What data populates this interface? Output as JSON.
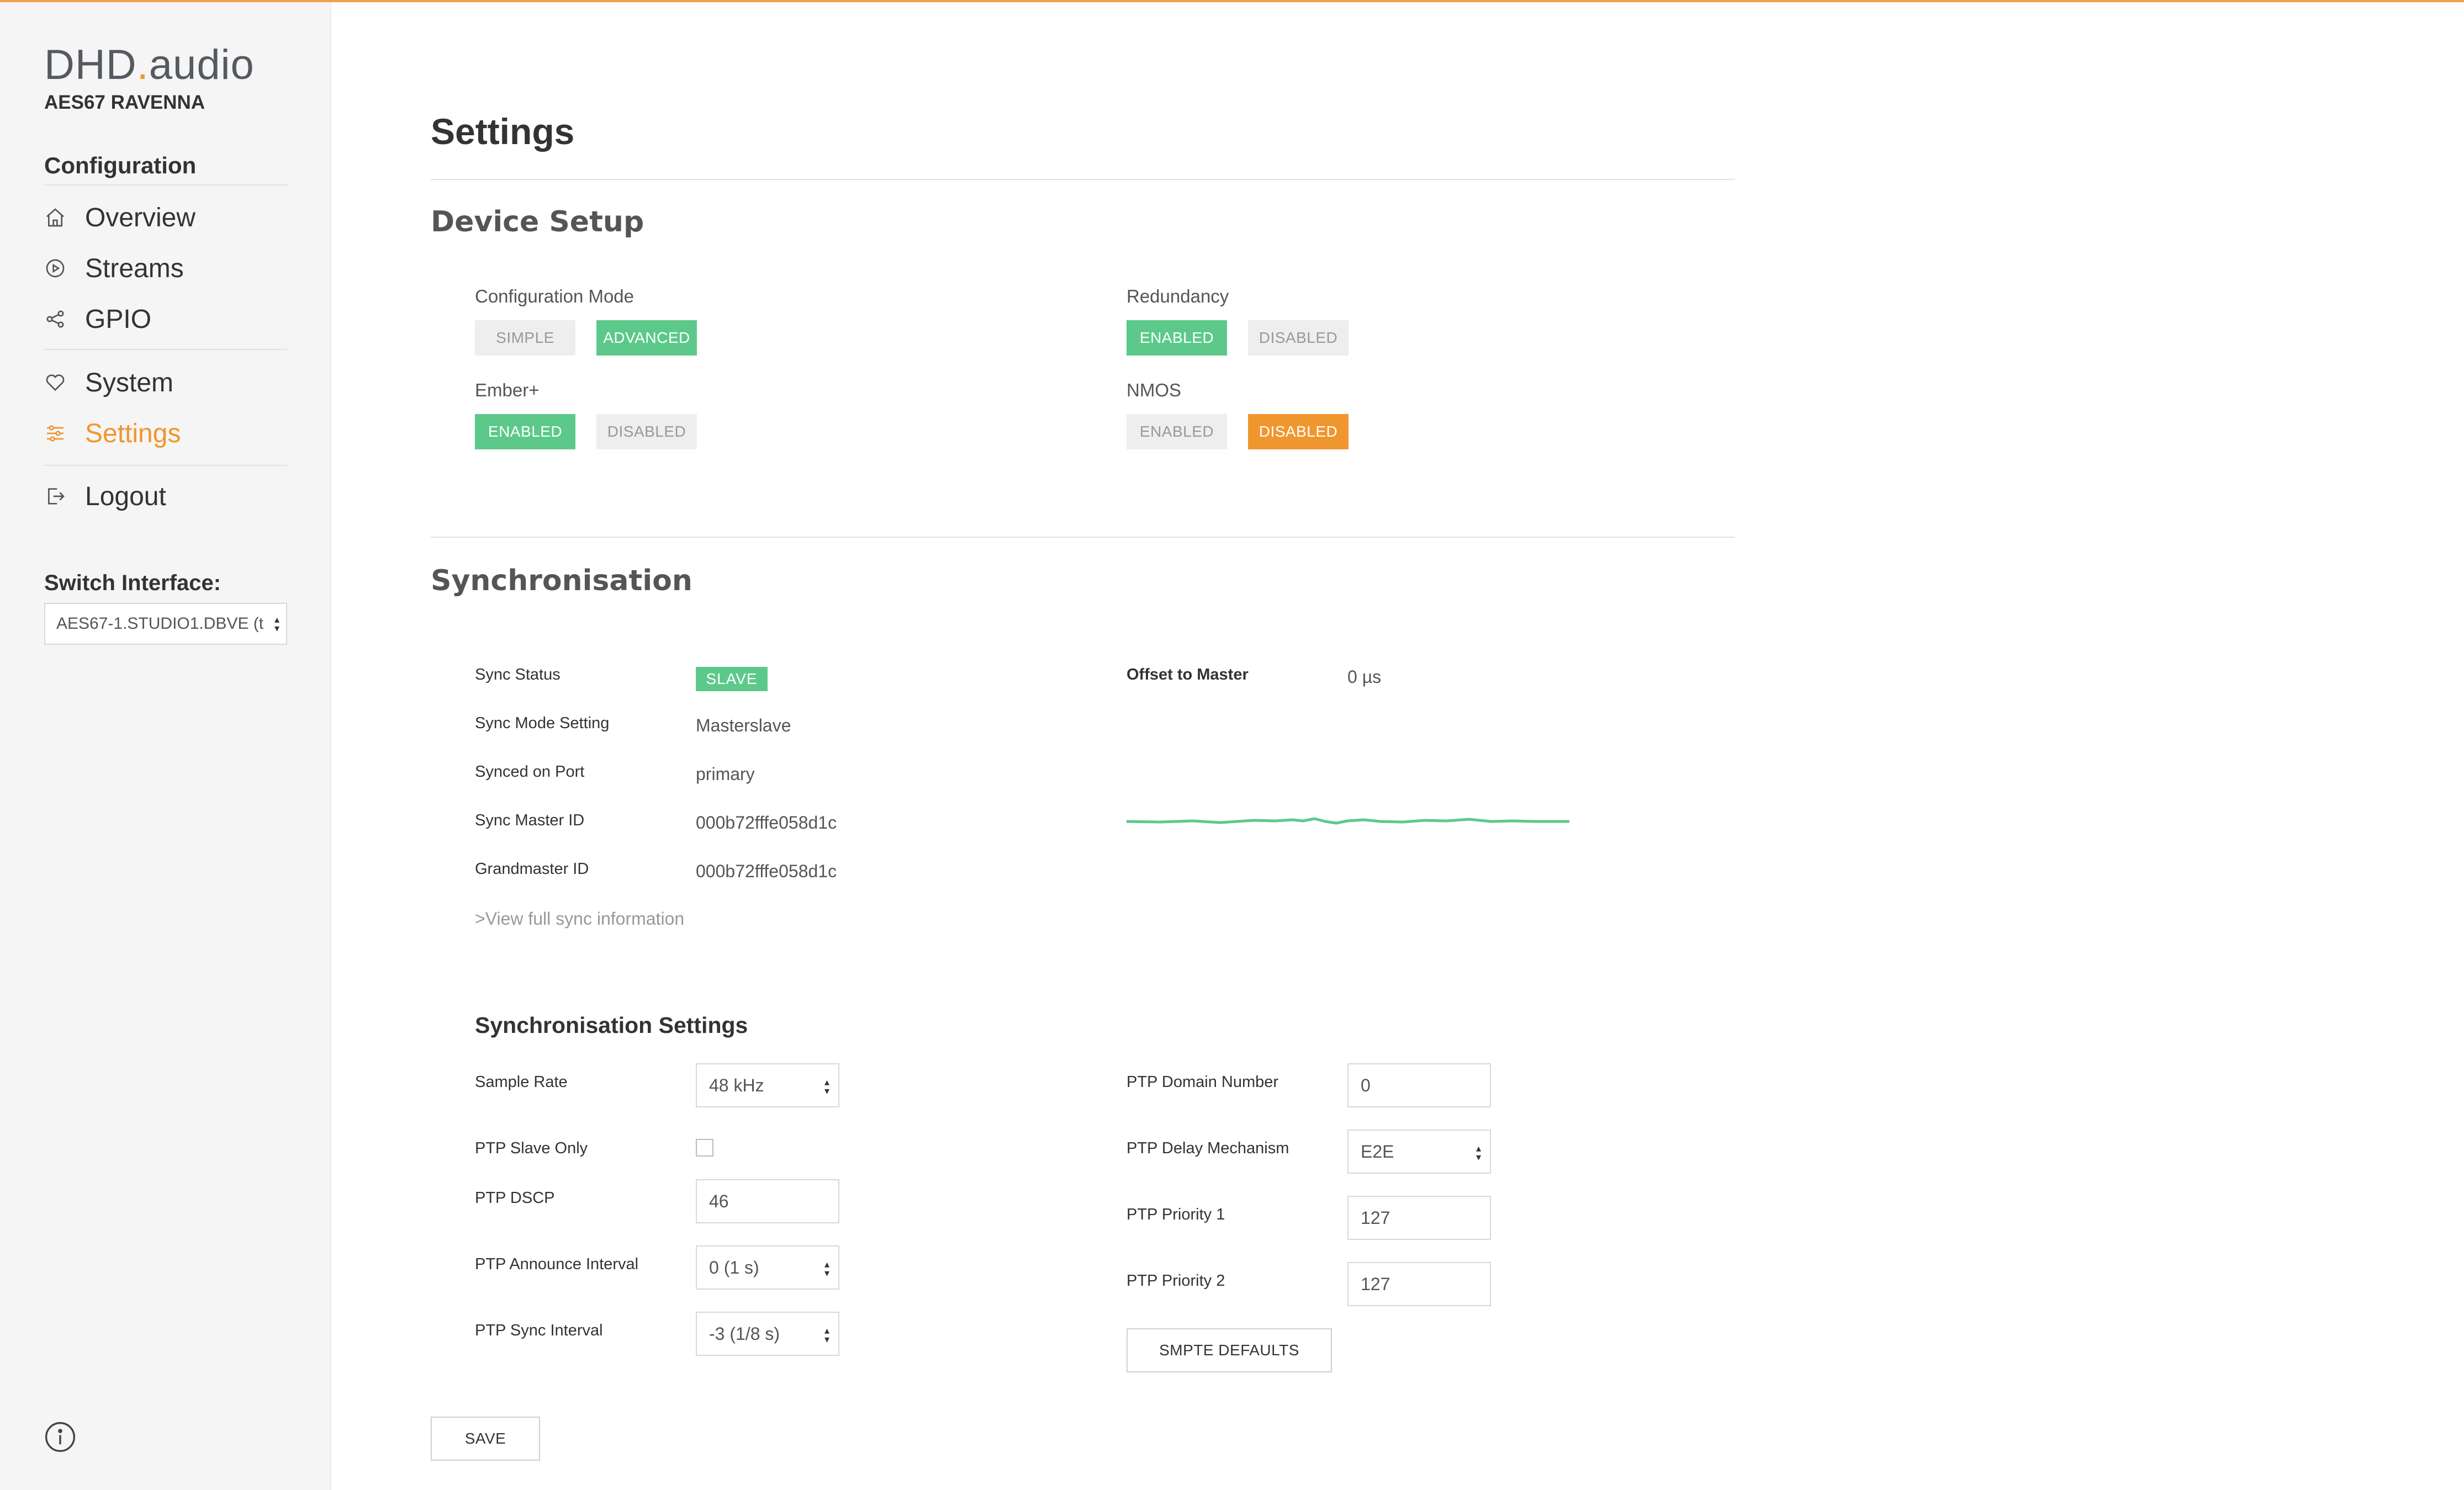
{
  "app": {
    "logo_main": "DHD",
    "logo_dot": ".",
    "logo_suffix": "audio",
    "subtitle": "AES67 RAVENNA",
    "accent_color": "#f0962e",
    "green_color": "#5cc98a"
  },
  "sidebar": {
    "section_title": "Configuration",
    "items": [
      {
        "label": "Overview",
        "icon": "home-icon"
      },
      {
        "label": "Streams",
        "icon": "play-circle-icon"
      },
      {
        "label": "GPIO",
        "icon": "share-icon"
      },
      {
        "label": "System",
        "icon": "heart-icon"
      },
      {
        "label": "Settings",
        "icon": "sliders-icon",
        "active": true
      },
      {
        "label": "Logout",
        "icon": "logout-icon"
      }
    ],
    "switch_interface_title": "Switch Interface:",
    "switch_interface_value": "AES67-1.STUDIO1.DBVE (t",
    "info_icon": "info-icon"
  },
  "page": {
    "title": "Settings"
  },
  "device_setup": {
    "heading": "Device Setup",
    "config_mode": {
      "label": "Configuration Mode",
      "options": [
        "SIMPLE",
        "ADVANCED"
      ],
      "selected": "ADVANCED"
    },
    "redundancy": {
      "label": "Redundancy",
      "options": [
        "ENABLED",
        "DISABLED"
      ],
      "selected": "ENABLED"
    },
    "ember": {
      "label": "Ember+",
      "options": [
        "ENABLED",
        "DISABLED"
      ],
      "selected": "ENABLED"
    },
    "nmos": {
      "label": "NMOS",
      "options": [
        "ENABLED",
        "DISABLED"
      ],
      "selected": "DISABLED"
    }
  },
  "synchronisation": {
    "heading": "Synchronisation",
    "sync_status_label": "Sync Status",
    "sync_status_value": "SLAVE",
    "sync_mode_label": "Sync Mode Setting",
    "sync_mode_value": "Masterslave",
    "synced_port_label": "Synced on Port",
    "synced_port_value": "primary",
    "master_id_label": "Sync Master ID",
    "master_id_value": "000b72fffe058d1c",
    "grandmaster_label": "Grandmaster ID",
    "grandmaster_value": "000b72fffe058d1c",
    "view_link": ">View full sync information",
    "offset_label": "Offset to Master",
    "offset_value": "0 µs"
  },
  "sync_settings": {
    "heading": "Synchronisation Settings",
    "sample_rate_label": "Sample Rate",
    "sample_rate_value": "48 kHz",
    "slave_only_label": "PTP Slave Only",
    "slave_only_checked": false,
    "dscp_label": "PTP DSCP",
    "dscp_value": "46",
    "announce_label": "PTP Announce Interval",
    "announce_value": "0 (1 s)",
    "sync_interval_label": "PTP Sync Interval",
    "sync_interval_value": "-3 (1/8 s)",
    "domain_label": "PTP Domain Number",
    "domain_value": "0",
    "delay_label": "PTP Delay Mechanism",
    "delay_value": "E2E",
    "priority1_label": "PTP Priority 1",
    "priority1_value": "127",
    "priority2_label": "PTP Priority 2",
    "priority2_value": "127",
    "smpte_button": "SMPTE DEFAULTS"
  },
  "actions": {
    "save_label": "SAVE"
  }
}
